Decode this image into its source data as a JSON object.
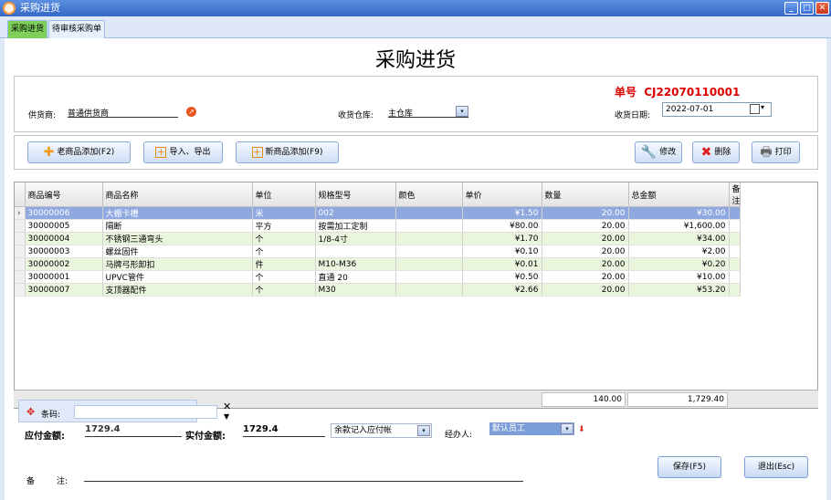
{
  "window": {
    "title": "采购进货"
  },
  "tabs": [
    {
      "label": "采购进货",
      "active": true
    },
    {
      "label": "待审核采购单",
      "active": false
    }
  ],
  "page_title": "采购进货",
  "order": {
    "label": "单号",
    "number": "CJ22070110001"
  },
  "supplier": {
    "label": "供货商:",
    "value": "普通供货商"
  },
  "warehouse": {
    "label": "收货仓库:",
    "value": "主仓库"
  },
  "receive_date": {
    "label": "收货日期:",
    "value": "2022-07-01"
  },
  "toolbar": {
    "add_old": "老商品添加(F2)",
    "import_export": "导入、导出",
    "add_new": "新商品添加(F9)",
    "edit": "修改",
    "delete": "删除",
    "print": "打印"
  },
  "table": {
    "columns": [
      "商品编号",
      "商品名称",
      "单位",
      "规格型号",
      "颜色",
      "单价",
      "数量",
      "总金额",
      "备注"
    ],
    "rows": [
      [
        "30000006",
        "大棚卡槽",
        "米",
        "002",
        "",
        "¥1.50",
        "20.00",
        "¥30.00",
        ""
      ],
      [
        "30000005",
        "隔断",
        "平方",
        "按需加工定制",
        "",
        "¥80.00",
        "20.00",
        "¥1,600.00",
        ""
      ],
      [
        "30000004",
        "不锈钢三通弯头",
        "个",
        "1/8-4寸",
        "",
        "¥1.70",
        "20.00",
        "¥34.00",
        ""
      ],
      [
        "30000003",
        "螺丝固件",
        "个",
        "",
        "",
        "¥0.10",
        "20.00",
        "¥2.00",
        ""
      ],
      [
        "30000002",
        "马牌弓形卸扣",
        "件",
        "M10-M36",
        "",
        "¥0.01",
        "20.00",
        "¥0.20",
        ""
      ],
      [
        "30000001",
        "UPVC管件",
        "个",
        "直通 20",
        "",
        "¥0.50",
        "20.00",
        "¥10.00",
        ""
      ],
      [
        "30000007",
        "支顶器配件",
        "个",
        "M30",
        "",
        "¥2.66",
        "20.00",
        "¥53.20",
        ""
      ]
    ],
    "total_qty": "140.00",
    "total_amount": "1,729.40"
  },
  "barcode": {
    "label": "条码:",
    "value": ""
  },
  "payable": {
    "label": "应付金额:",
    "value": "1729.4"
  },
  "actual": {
    "label": "实付金额:",
    "value": "1729.4"
  },
  "balance_option": {
    "value": "余款记入应付帐"
  },
  "handler": {
    "label": "经办人:",
    "value": "默认员工"
  },
  "remark": {
    "label1": "备",
    "label2": "注:",
    "value": ""
  },
  "buttons": {
    "save": "保存(F5)",
    "exit": "退出(Esc)"
  },
  "colors": {
    "selected_row": "#8fa8e0",
    "alt_row": "#eaf5dd",
    "order_no": "#dd0000",
    "active_tab": "#7ed05a"
  }
}
